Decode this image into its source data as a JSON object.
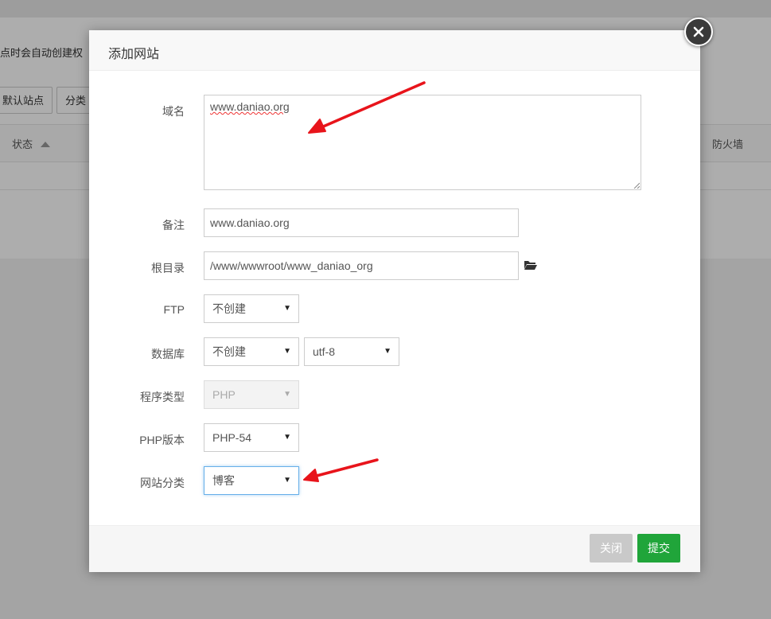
{
  "background": {
    "notice_text": "点时会自动创建权",
    "buttons": [
      "默认站点",
      "分类"
    ],
    "table_headers": [
      "状态",
      "防火墙"
    ]
  },
  "modal": {
    "title": "添加网站",
    "close_icon": "close-icon",
    "fields": {
      "domain": {
        "label": "域名",
        "value": "www.daniao.org"
      },
      "note": {
        "label": "备注",
        "value": "www.daniao.org"
      },
      "root_dir": {
        "label": "根目录",
        "value": "/www/wwwroot/www_daniao_org",
        "icon": "folder-open-icon"
      },
      "ftp": {
        "label": "FTP",
        "value": "不创建"
      },
      "database": {
        "label": "数据库",
        "value": "不创建",
        "charset": "utf-8"
      },
      "program_type": {
        "label": "程序类型",
        "value": "PHP"
      },
      "php_version": {
        "label": "PHP版本",
        "value": "PHP-54"
      },
      "site_category": {
        "label": "网站分类",
        "value": "博客"
      }
    },
    "footer": {
      "close_label": "关闭",
      "submit_label": "提交"
    }
  },
  "colors": {
    "submit": "#20a53a",
    "close_disabled": "#c9c9c9",
    "annotation_arrow": "#e8141b"
  }
}
